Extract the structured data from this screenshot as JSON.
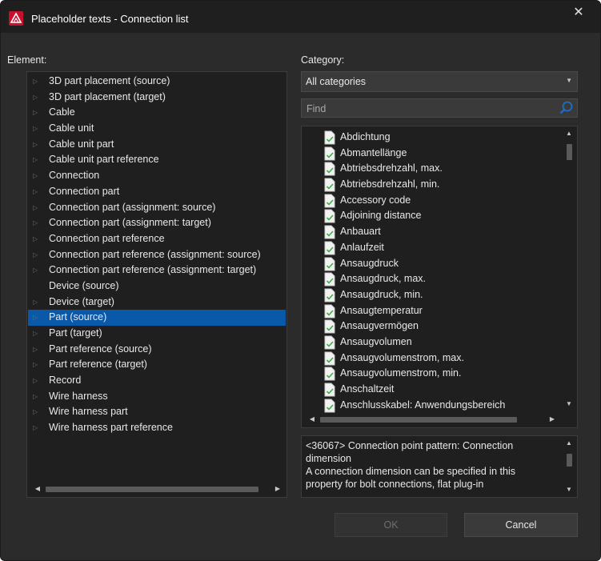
{
  "window": {
    "title": "Placeholder texts - Connection list",
    "close": "✕"
  },
  "element": {
    "label": "Element:",
    "selected_index": 16,
    "items": [
      {
        "label": "3D part placement (source)",
        "expandable": true
      },
      {
        "label": "3D part placement (target)",
        "expandable": true
      },
      {
        "label": "Cable",
        "expandable": true
      },
      {
        "label": "Cable unit",
        "expandable": true
      },
      {
        "label": "Cable unit part",
        "expandable": true
      },
      {
        "label": "Cable unit part reference",
        "expandable": true
      },
      {
        "label": "Connection",
        "expandable": true
      },
      {
        "label": "Connection part",
        "expandable": true
      },
      {
        "label": "Connection part (assignment: source)",
        "expandable": true
      },
      {
        "label": "Connection part (assignment: target)",
        "expandable": true
      },
      {
        "label": "Connection part reference",
        "expandable": true
      },
      {
        "label": "Connection part reference (assignment: source)",
        "expandable": true
      },
      {
        "label": "Connection part reference (assignment: target)",
        "expandable": true
      },
      {
        "label": "Device (source)",
        "expandable": false
      },
      {
        "label": "Device (target)",
        "expandable": true
      },
      {
        "label": "Part (source)",
        "expandable": true
      },
      {
        "label": "Part (target)",
        "expandable": true
      },
      {
        "label": "Part reference (source)",
        "expandable": true
      },
      {
        "label": "Part reference (target)",
        "expandable": true
      },
      {
        "label": "Record",
        "expandable": true
      },
      {
        "label": "Wire harness",
        "expandable": true
      },
      {
        "label": "Wire harness part",
        "expandable": true
      },
      {
        "label": "Wire harness part reference",
        "expandable": true
      }
    ]
  },
  "category": {
    "label": "Category:",
    "selected": "All categories",
    "find_placeholder": "Find",
    "items": [
      "Abdichtung",
      "Abmantellänge",
      "Abtriebsdrehzahl, max.",
      "Abtriebsdrehzahl, min.",
      "Accessory code",
      "Adjoining distance",
      "Anbauart",
      "Anlaufzeit",
      "Ansaugdruck",
      "Ansaugdruck, max.",
      "Ansaugdruck, min.",
      "Ansaugtemperatur",
      "Ansaugvermögen",
      "Ansaugvolumen",
      "Ansaugvolumenstrom, max.",
      "Ansaugvolumenstrom, min.",
      "Anschaltzeit",
      "Anschlusskabel: Anwendungsbereich"
    ]
  },
  "description": {
    "line1": "<36067> Connection point pattern: Connection",
    "line2": "dimension",
    "line3": "A connection dimension can be specified in this",
    "line4": "property for bolt connections, flat plug-in"
  },
  "buttons": {
    "ok": "OK",
    "cancel": "Cancel"
  },
  "colors": {
    "selection": "#0a58a8",
    "brand": "#c8102e",
    "doc_check": "#3fae49"
  }
}
